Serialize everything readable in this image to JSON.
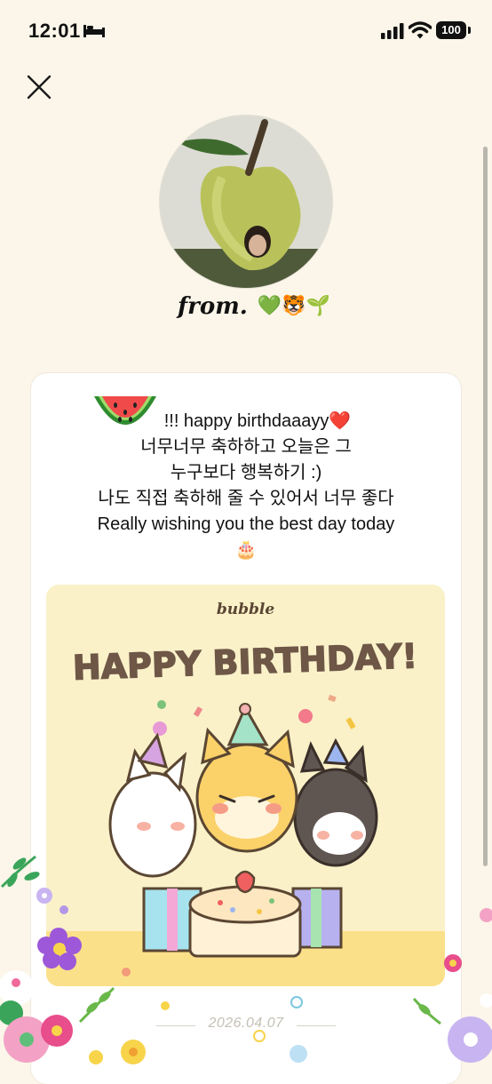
{
  "status_bar": {
    "time": "12:01",
    "battery": "100",
    "icons": [
      "bed-icon",
      "cellular-signal-icon",
      "wifi-icon",
      "battery-icon"
    ]
  },
  "header": {
    "close_icon": "close-icon"
  },
  "sender": {
    "from_label": "from.",
    "emojis": "💚🐯🌱"
  },
  "letter": {
    "lines": [
      "!!! happy birthdaaayy❤️",
      "너무너무 축하하고 오늘은 그",
      "누구보다 행복하기 :)",
      "나도 직접 축하해 줄 수 있어서 너무 좋다",
      "Really wishing you the best day today",
      "🎂"
    ],
    "leading_sticker": "watermelon-icon",
    "date": "2026.04.07"
  },
  "birthday_card": {
    "brand": "bubble",
    "headline": "HAPPY BIRTHDAY!",
    "colors": {
      "background": "#faf1c9",
      "headline": "#6e5747",
      "ground": "#fbe08a"
    }
  },
  "colors": {
    "page_background": "#fbf6e9",
    "card_background": "#ffffff",
    "date_text": "#c4c0b6"
  }
}
